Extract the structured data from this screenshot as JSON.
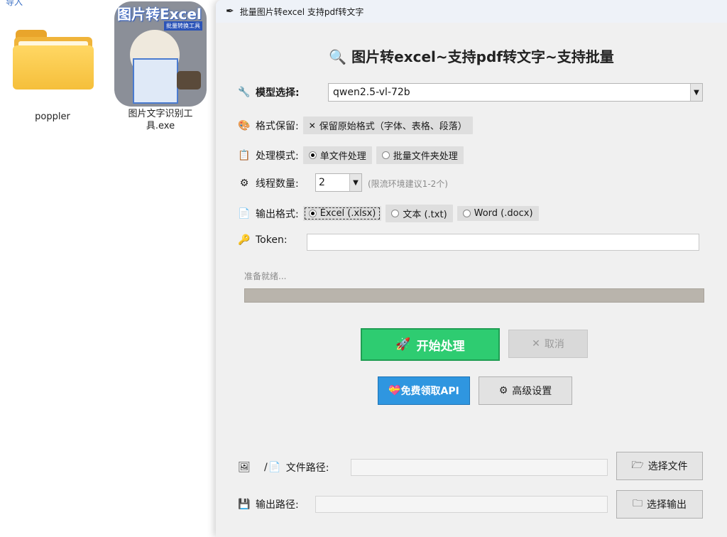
{
  "desktop": {
    "top_text": "导入",
    "items": [
      {
        "label": "poppler"
      },
      {
        "label": "图片文字识别工具.exe",
        "icon_title": "图片转Excel",
        "icon_sub": "批量转换工具"
      }
    ]
  },
  "window": {
    "title": "批量图片转excel 支持pdf转文字",
    "heading": "🔍 图片转excel~支持pdf转文字~支持批量",
    "model": {
      "label": "模型选择:",
      "value": "qwen2.5-vl-72b"
    },
    "format_keep": {
      "label": "格式保留:",
      "option": "保留原始格式（字体、表格、段落）",
      "checked": true
    },
    "process_mode": {
      "label": "处理模式:",
      "options": [
        "单文件处理",
        "批量文件夹处理"
      ],
      "selected": 0
    },
    "threads": {
      "label": "线程数量:",
      "value": "2",
      "hint": "(限流环境建议1-2个)"
    },
    "output_format": {
      "label": "输出格式:",
      "options": [
        "Excel (.xlsx)",
        "文本 (.txt)",
        "Word (.docx)"
      ],
      "selected": 0
    },
    "token": {
      "label": "Token:",
      "value": ""
    },
    "status": "准备就绪...",
    "progress": 0,
    "buttons": {
      "start": "开始处理",
      "cancel": "取消",
      "api": "免费领取API",
      "advanced": "高级设置",
      "pick_file": "选择文件",
      "pick_output": "选择输出"
    },
    "file_path": {
      "label": "文件路径:",
      "prefix": "/",
      "value": ""
    },
    "output_path": {
      "label": "输出路径:",
      "value": ""
    },
    "colors": {
      "start": "#2ecc71",
      "api": "#2f96e0",
      "progress": "#b9b4ac"
    }
  }
}
